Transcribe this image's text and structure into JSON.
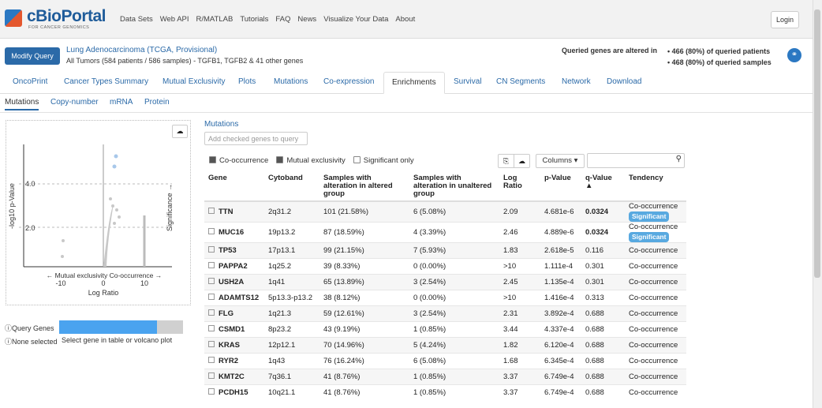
{
  "brand": {
    "name": "cBioPortal",
    "tagline": "FOR CANCER GENOMICS"
  },
  "topnav": [
    "Data Sets",
    "Web API",
    "R/MATLAB",
    "Tutorials",
    "FAQ",
    "News",
    "Visualize Your Data",
    "About"
  ],
  "login_label": "Login",
  "query": {
    "modify_label": "Modify Query",
    "study": "Lung Adenocarcinoma (TCGA, Provisional)",
    "meta": "All Tumors (584 patients / 586 samples) - TGFB1, TGFB2 & 41 other genes",
    "altered_label": "Queried genes are altered in",
    "stat_patients": "• 466 (80%) of queried patients",
    "stat_samples": "• 468 (80%) of queried samples"
  },
  "tabs": [
    "OncoPrint",
    "Cancer Types Summary",
    "Mutual Exclusivity",
    "Plots",
    "Mutations",
    "Co-expression",
    "Enrichments",
    "Survival",
    "CN Segments",
    "Network",
    "Download"
  ],
  "active_tab": "Enrichments",
  "subtabs": [
    "Mutations",
    "Copy-number",
    "mRNA",
    "Protein"
  ],
  "volcano": {
    "ylabel": "-log10 p-Value",
    "xlabel": "Log Ratio",
    "xlegend": "← Mutual exclusivity Co-occurrence →",
    "sig_label": "Significance →",
    "yticks": [
      "4.0",
      "2.0"
    ],
    "xticks": [
      "-10",
      "0",
      "10"
    ]
  },
  "query_genes": {
    "label": "Query Genes",
    "note": "None selected",
    "hint": "Select gene in table or volcano plot",
    "fraction_filled": 0.79
  },
  "mutations_title": "Mutations",
  "add_genes_label": "Add checked genes to query",
  "filters": {
    "co": "Co-occurrence",
    "mutual": "Mutual exclusivity",
    "sig_only": "Significant only"
  },
  "columns_label": "Columns ▾",
  "table": {
    "headers": [
      "Gene",
      "Cytoband",
      "Samples with alteration in altered group",
      "Samples with alteration in unaltered group",
      "Log Ratio",
      "p-Value",
      "q-Value ▲",
      "Tendency"
    ],
    "rows": [
      {
        "gene": "TTN",
        "cyto": "2q31.2",
        "alt": "101 (21.58%)",
        "unalt": "6 (5.08%)",
        "lr": "2.09",
        "p": "4.681e-6",
        "q": "0.0324",
        "tend": "Co-occurrence",
        "sig": "Significant"
      },
      {
        "gene": "MUC16",
        "cyto": "19p13.2",
        "alt": "87 (18.59%)",
        "unalt": "4 (3.39%)",
        "lr": "2.46",
        "p": "4.889e-6",
        "q": "0.0324",
        "tend": "Co-occurrence",
        "sig": "Significant"
      },
      {
        "gene": "TP53",
        "cyto": "17p13.1",
        "alt": "99 (21.15%)",
        "unalt": "7 (5.93%)",
        "lr": "1.83",
        "p": "2.618e-5",
        "q": "0.116",
        "tend": "Co-occurrence"
      },
      {
        "gene": "PAPPA2",
        "cyto": "1q25.2",
        "alt": "39 (8.33%)",
        "unalt": "0 (0.00%)",
        "lr": ">10",
        "p": "1.111e-4",
        "q": "0.301",
        "tend": "Co-occurrence"
      },
      {
        "gene": "USH2A",
        "cyto": "1q41",
        "alt": "65 (13.89%)",
        "unalt": "3 (2.54%)",
        "lr": "2.45",
        "p": "1.135e-4",
        "q": "0.301",
        "tend": "Co-occurrence"
      },
      {
        "gene": "ADAMTS12",
        "cyto": "5p13.3-p13.2",
        "alt": "38 (8.12%)",
        "unalt": "0 (0.00%)",
        "lr": ">10",
        "p": "1.416e-4",
        "q": "0.313",
        "tend": "Co-occurrence"
      },
      {
        "gene": "FLG",
        "cyto": "1q21.3",
        "alt": "59 (12.61%)",
        "unalt": "3 (2.54%)",
        "lr": "2.31",
        "p": "3.892e-4",
        "q": "0.688",
        "tend": "Co-occurrence"
      },
      {
        "gene": "CSMD1",
        "cyto": "8p23.2",
        "alt": "43 (9.19%)",
        "unalt": "1 (0.85%)",
        "lr": "3.44",
        "p": "4.337e-4",
        "q": "0.688",
        "tend": "Co-occurrence"
      },
      {
        "gene": "KRAS",
        "cyto": "12p12.1",
        "alt": "70 (14.96%)",
        "unalt": "5 (4.24%)",
        "lr": "1.82",
        "p": "6.120e-4",
        "q": "0.688",
        "tend": "Co-occurrence"
      },
      {
        "gene": "RYR2",
        "cyto": "1q43",
        "alt": "76 (16.24%)",
        "unalt": "6 (5.08%)",
        "lr": "1.68",
        "p": "6.345e-4",
        "q": "0.688",
        "tend": "Co-occurrence"
      },
      {
        "gene": "KMT2C",
        "cyto": "7q36.1",
        "alt": "41 (8.76%)",
        "unalt": "1 (0.85%)",
        "lr": "3.37",
        "p": "6.749e-4",
        "q": "0.688",
        "tend": "Co-occurrence"
      },
      {
        "gene": "PCDH15",
        "cyto": "10q21.1",
        "alt": "41 (8.76%)",
        "unalt": "1 (0.85%)",
        "lr": "3.37",
        "p": "6.749e-4",
        "q": "0.688",
        "tend": "Co-occurrence"
      }
    ]
  },
  "colors": {
    "brand": "#1f5c9a",
    "link": "#2b6aa8",
    "significant": "#58a9e0",
    "bar": "#4aa3ef"
  }
}
